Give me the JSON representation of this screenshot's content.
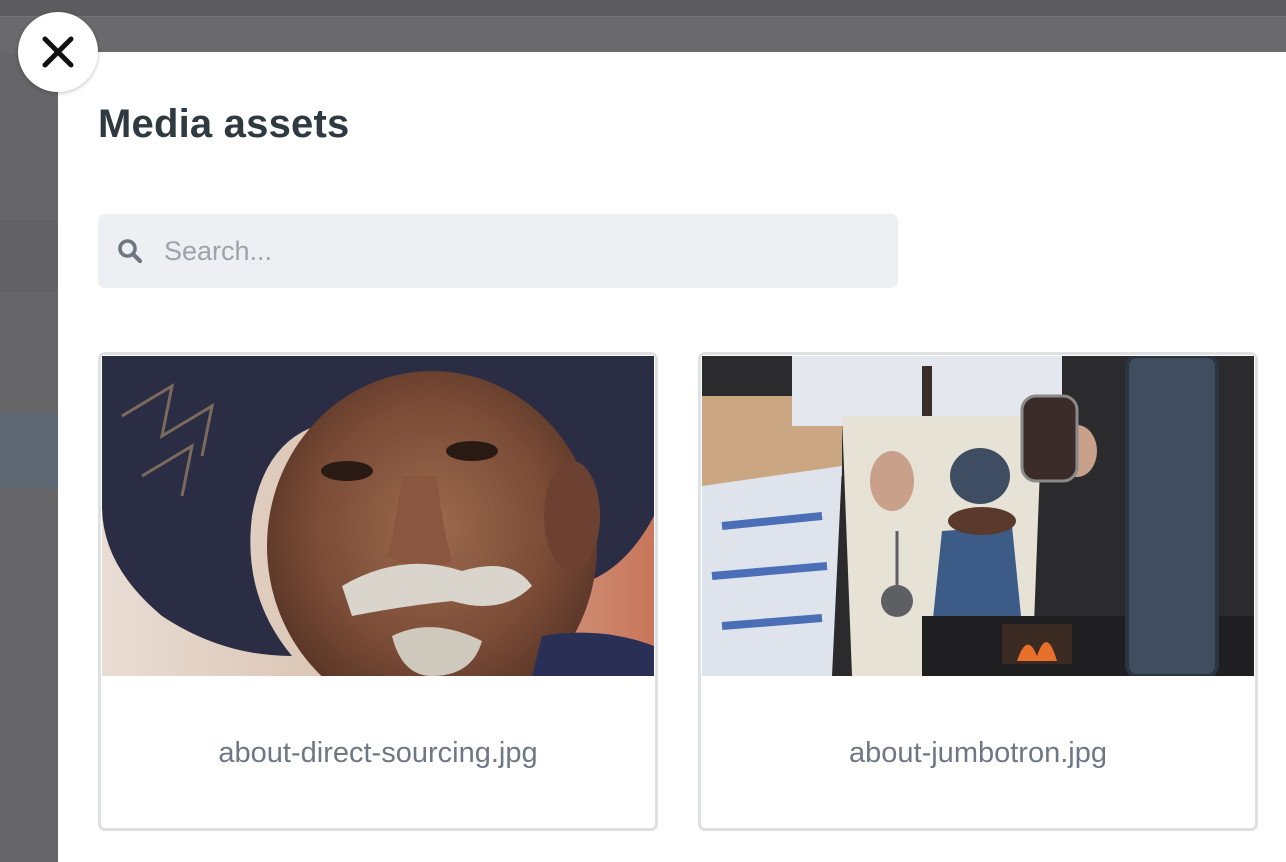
{
  "modal": {
    "title": "Media assets",
    "close_icon": "close-icon"
  },
  "search": {
    "placeholder": "Search...",
    "value": "",
    "icon": "search-icon"
  },
  "assets": [
    {
      "filename": "about-direct-sourcing.jpg",
      "thumbnail": "portrait of smiling elderly man in wide-brim hat"
    },
    {
      "filename": "about-jumbotron.jpg",
      "thumbnail": "person pouring coffee from kettle over wood stove"
    }
  ],
  "colors": {
    "backdrop": "#666668",
    "panel": "#ffffff",
    "title": "#2f3a40",
    "search_bg": "#eeeff3",
    "placeholder": "#9ea3aa",
    "card_border": "#dfe0e4",
    "filename": "#6e7884"
  }
}
